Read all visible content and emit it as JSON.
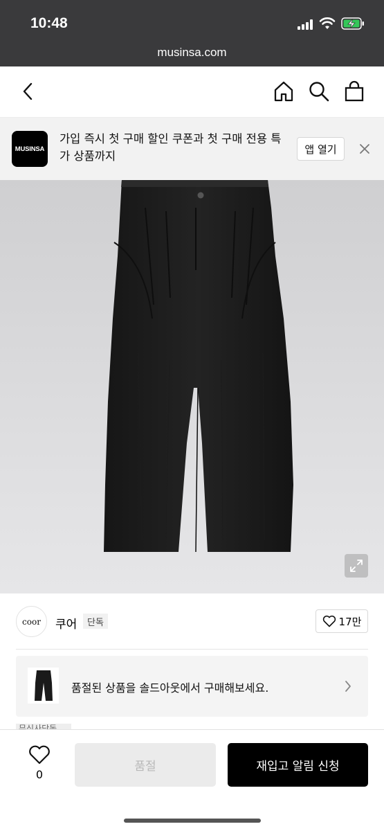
{
  "status_bar": {
    "time": "10:48",
    "url": "musinsa.com",
    "battery_color": "#34c759"
  },
  "navbar": {
    "icons": [
      "back-icon",
      "home-icon",
      "search-icon",
      "cart-icon"
    ]
  },
  "banner": {
    "app_logo_text": "MUSINSA",
    "message": "가입 즉시 첫 구매 할인 쿠폰과 첫 구매 전용 특가 상품까지",
    "open_app_label": "앱 열기",
    "close_icon": "close-icon"
  },
  "product_image": {
    "expand_icon": "expand-icon"
  },
  "brand": {
    "logo_text": "coor",
    "name": "쿠어",
    "tag": "단독",
    "like_count": "17만"
  },
  "soldout_card": {
    "message": "품절된 상품을 솔드아웃에서 구매해보세요."
  },
  "peek_badge": "무신사단독",
  "bottom_bar": {
    "wish_count": "0",
    "soldout_label": "품절",
    "restock_label": "재입고 알림 신청"
  },
  "colors": {
    "primary_button": "#000000",
    "disabled_button": "#ebebeb",
    "status_bar": "#3a3a3c"
  }
}
